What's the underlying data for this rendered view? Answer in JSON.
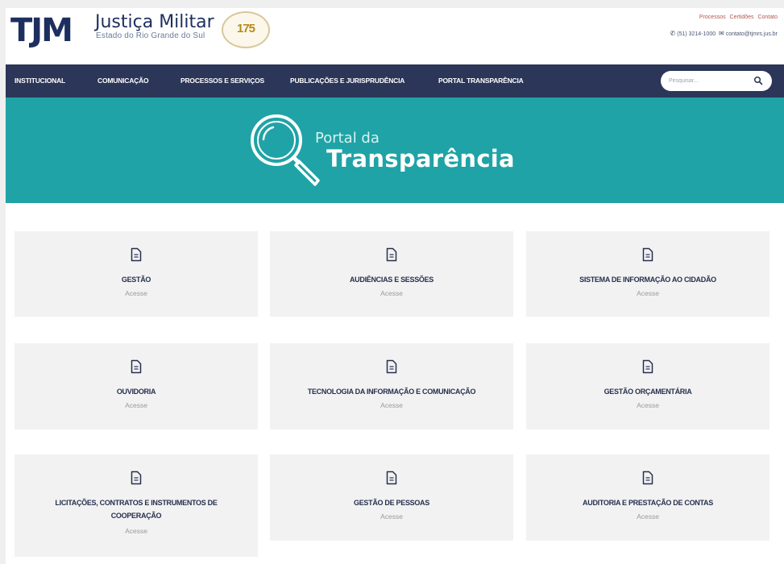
{
  "header": {
    "logo_text": "TJM",
    "org_name": "Justiça Militar",
    "org_subtitle": "Estado do Rio Grande do Sul",
    "seal_text": "175",
    "top_links": [
      "Processos",
      "Certidões",
      "Contato"
    ],
    "phone": "(51) 3214-1000",
    "email": "contato@tjmrs.jus.br"
  },
  "nav": {
    "items": [
      "INSTITUCIONAL",
      "COMUNICAÇÃO",
      "PROCESSOS E SERVIÇOS",
      "PUBLICAÇÕES E JURISPRUDÊNCIA",
      "PORTAL TRANSPARÊNCIA"
    ],
    "search_placeholder": "Pesquisar..."
  },
  "banner": {
    "small": "Portal da",
    "big": "Transparência"
  },
  "cards": [
    {
      "title": "GESTÃO",
      "link": "Acesse"
    },
    {
      "title": "AUDIÊNCIAS E SESSÕES",
      "link": "Acesse"
    },
    {
      "title": "SISTEMA DE INFORMAÇÃO AO CIDADÃO",
      "link": "Acesse"
    },
    {
      "title": "OUVIDORIA",
      "link": "Acesse"
    },
    {
      "title": "TECNOLOGIA DA INFORMAÇÃO E COMUNICAÇÃO",
      "link": "Acesse"
    },
    {
      "title": "GESTÃO ORÇAMENTÁRIA",
      "link": "Acesse"
    },
    {
      "title": "LICITAÇÕES, CONTRATOS E INSTRUMENTOS DE COOPERAÇÃO",
      "link": "Acesse"
    },
    {
      "title": "GESTÃO DE PESSOAS",
      "link": "Acesse"
    },
    {
      "title": "AUDITORIA E PRESTAÇÃO DE CONTAS",
      "link": "Acesse"
    }
  ],
  "colors": {
    "nav_bg": "#2b3658",
    "banner_bg": "#1fa3a6",
    "card_bg": "#f2f2f2",
    "title": "#26304e",
    "top_link": "#b0584c"
  }
}
